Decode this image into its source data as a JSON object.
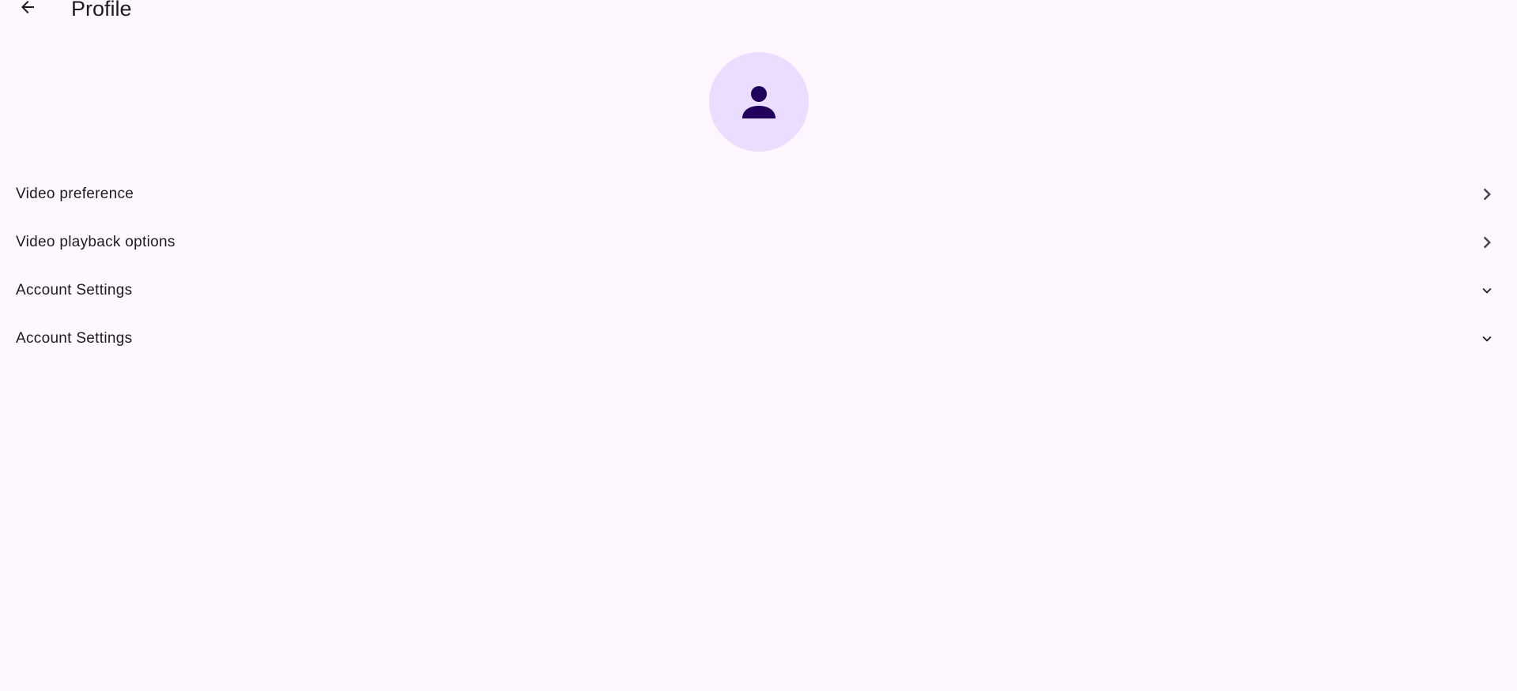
{
  "header": {
    "title": "Profile",
    "back_icon": "arrow-back-icon"
  },
  "avatar": {
    "icon": "person-icon",
    "background": "#EADDFF",
    "icon_color": "#21005D"
  },
  "menu": {
    "items": [
      {
        "label": "Video preference",
        "trailing_icon": "chevron-right-icon"
      },
      {
        "label": "Video playback options",
        "trailing_icon": "chevron-right-icon"
      },
      {
        "label": "Account Settings",
        "trailing_icon": "chevron-down-icon"
      },
      {
        "label": "Account Settings",
        "trailing_icon": "chevron-down-icon"
      }
    ]
  },
  "theme": {
    "background": "#FEF7FF",
    "text": "#1D1B20",
    "icon": "#49454F"
  }
}
